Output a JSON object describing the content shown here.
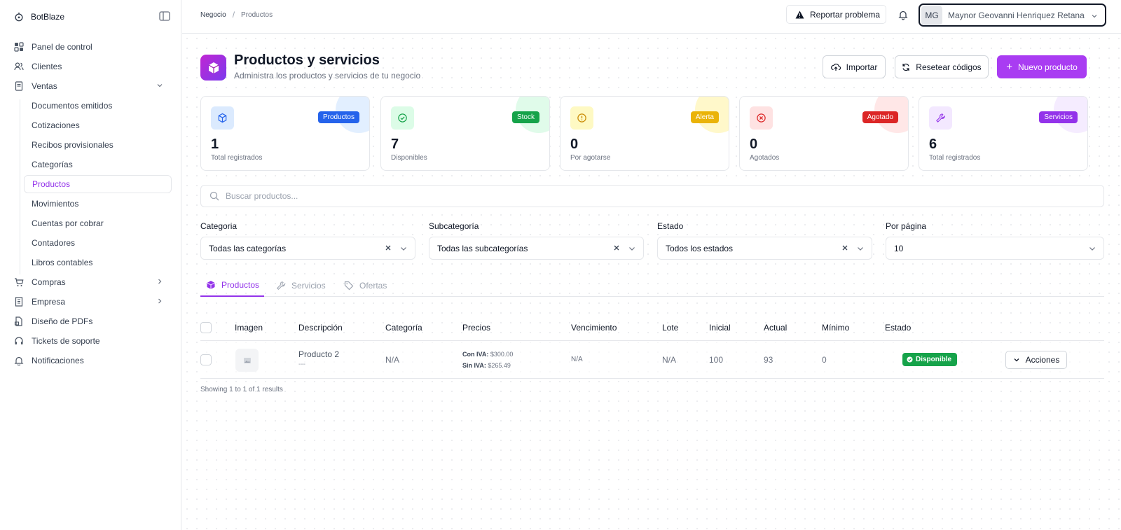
{
  "brand": {
    "name": "BotBlaze"
  },
  "sidebar": {
    "items": [
      {
        "label": "Panel de control",
        "icon": "dashboard-icon"
      },
      {
        "label": "Clientes",
        "icon": "users-icon"
      },
      {
        "label": "Ventas",
        "icon": "receipt-icon"
      },
      {
        "label": "Compras",
        "icon": "cart-icon"
      },
      {
        "label": "Empresa",
        "icon": "building-icon"
      },
      {
        "label": "Diseño de PDFs",
        "icon": "pdf-icon"
      },
      {
        "label": "Tickets de soporte",
        "icon": "headset-icon"
      },
      {
        "label": "Notificaciones",
        "icon": "bell-icon"
      }
    ],
    "ventas_sub": [
      "Documentos emitidos",
      "Cotizaciones",
      "Recibos provisionales",
      "Categorías",
      "Productos",
      "Movimientos",
      "Cuentas por cobrar",
      "Contadores",
      "Libros contables"
    ]
  },
  "topbar": {
    "breadcrumb": [
      "Negocio",
      "Productos"
    ],
    "breadcrumb_sep": "/",
    "report_label": "Reportar problema",
    "user_initials": "MG",
    "user_name": "Maynor Geovanni Henriquez Retana"
  },
  "header": {
    "title": "Productos y servicios",
    "subtitle": "Administra los productos y servicios de tu negocio",
    "import_label": "Importar",
    "reset_label": "Resetear códigos",
    "new_label": "Nuevo producto"
  },
  "cards": [
    {
      "value": "1",
      "label": "Total registrados",
      "badge": "Productos",
      "color": "#2563eb",
      "tint": "#dbeafe"
    },
    {
      "value": "7",
      "label": "Disponibles",
      "badge": "Stock",
      "color": "#16a34a",
      "tint": "#dcfce7"
    },
    {
      "value": "0",
      "label": "Por agotarse",
      "badge": "Alerta",
      "color": "#eab308",
      "tint": "#fef9c3"
    },
    {
      "value": "0",
      "label": "Agotados",
      "badge": "Agotado",
      "color": "#dc2626",
      "tint": "#fee2e2"
    },
    {
      "value": "6",
      "label": "Total registrados",
      "badge": "Servicios",
      "color": "#9333ea",
      "tint": "#f3e8ff"
    }
  ],
  "search": {
    "placeholder": "Buscar productos..."
  },
  "filters": {
    "categoria": {
      "label": "Categoria",
      "value": "Todas las categorías"
    },
    "subcategoria": {
      "label": "Subcategoría",
      "value": "Todas las subcategorías"
    },
    "estado": {
      "label": "Estado",
      "value": "Todos los estados"
    },
    "por_pagina": {
      "label": "Por página",
      "value": "10"
    }
  },
  "tabs": [
    {
      "label": "Productos"
    },
    {
      "label": "Servicios"
    },
    {
      "label": "Ofertas"
    }
  ],
  "table": {
    "headers": [
      "Imagen",
      "Descripción",
      "Categoría",
      "Precios",
      "Vencimiento",
      "Lote",
      "Inicial",
      "Actual",
      "Mínimo",
      "Estado"
    ],
    "rows": [
      {
        "name": "Producto 2",
        "desc": "---",
        "category": "N/A",
        "price_with_label": "Con IVA:",
        "price_with": "$300.00",
        "price_without_label": "Sin IVA:",
        "price_without": "$265.49",
        "expiry": "N/A",
        "lot": "N/A",
        "initial": "100",
        "current": "93",
        "minimum": "0",
        "status": "Disponible",
        "actions_label": "Acciones"
      }
    ]
  },
  "results_text": "Showing 1 to 1 of 1 results"
}
